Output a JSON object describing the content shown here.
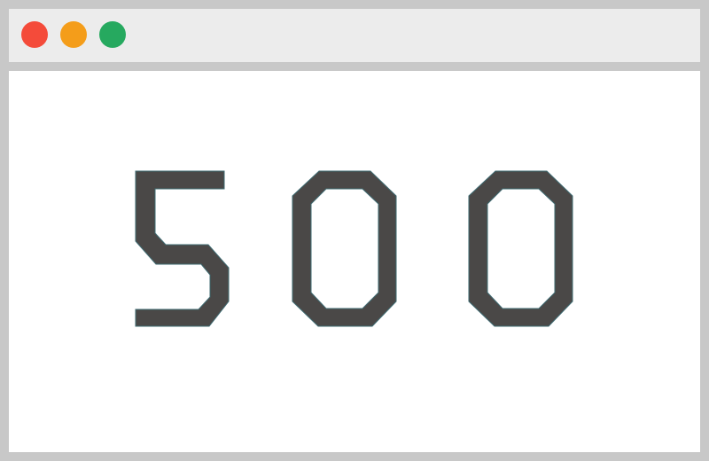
{
  "window": {
    "controls": [
      {
        "name": "close",
        "color": "#f44b3a"
      },
      {
        "name": "minimize",
        "color": "#f49d1a"
      },
      {
        "name": "maximize",
        "color": "#26a95f"
      }
    ]
  },
  "error": {
    "code": "500",
    "digit_color": "#4a4847",
    "digit_outline_color": "#3f6b72"
  }
}
